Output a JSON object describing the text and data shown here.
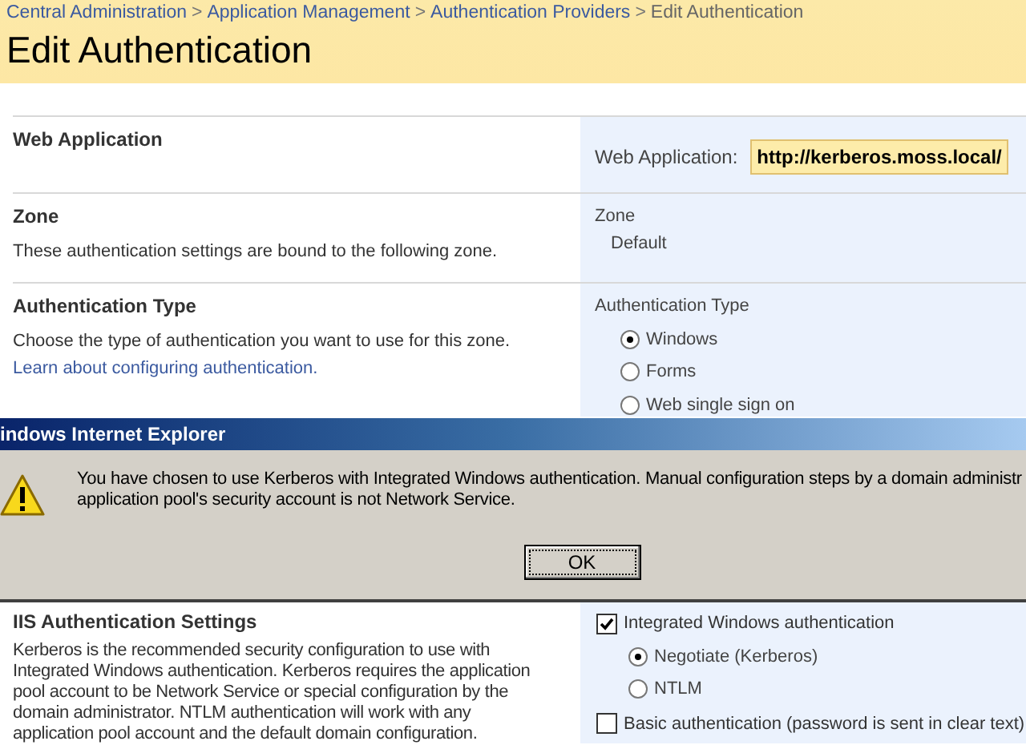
{
  "breadcrumb_separator": ">",
  "breadcrumb": [
    {
      "text": "Central Administration",
      "link": true
    },
    {
      "text": "Application Management",
      "link": true
    },
    {
      "text": "Authentication Providers",
      "link": true
    },
    {
      "text": "Edit Authentication",
      "link": false
    }
  ],
  "title": "Edit Authentication",
  "sections": [
    {
      "title": "Web Application",
      "items": [
        {
          "kind": "field",
          "label": "Web Application:",
          "value": "http://kerberos.moss.local/"
        }
      ]
    },
    {
      "title": "Zone",
      "description": "These authentication settings are bound to the following zone.",
      "items": [
        {
          "kind": "caption",
          "text": "Zone"
        },
        {
          "kind": "text",
          "text": "Default"
        }
      ]
    },
    {
      "title": "Authentication Type",
      "description": "Choose the type of authentication you want to use for this zone.",
      "link": "Learn about configuring authentication.",
      "items": [
        {
          "kind": "caption",
          "text": "Authentication Type"
        },
        {
          "kind": "radio",
          "text": "Windows",
          "selected": true
        },
        {
          "kind": "radio",
          "text": "Forms",
          "selected": false
        },
        {
          "kind": "radio",
          "text": "Web single sign on",
          "selected": false
        }
      ]
    }
  ],
  "dialog": {
    "title": "indows Internet Explorer",
    "message_lines": [
      "You have chosen to use Kerberos with Integrated Windows authentication. Manual configuration steps by a domain administr",
      "application pool's security account is not Network Service."
    ],
    "button": "OK"
  },
  "iis": {
    "title": "IIS Authentication Settings",
    "description_lines": [
      "Kerberos is the recommended security configuration to use with",
      "Integrated Windows authentication.  Kerberos requires the application",
      "pool account to be Network Service or special configuration by the",
      "domain administrator.  NTLM authentication will work with any",
      "application pool account and the default domain configuration."
    ],
    "items": [
      {
        "kind": "checkbox",
        "text": "Integrated Windows authentication",
        "checked": true,
        "children": [
          {
            "kind": "radio",
            "text": "Negotiate (Kerberos)",
            "selected": true
          },
          {
            "kind": "radio",
            "text": "NTLM",
            "selected": false
          }
        ]
      },
      {
        "kind": "checkbox",
        "text": "Basic authentication (password is sent in clear text)",
        "checked": false
      }
    ]
  }
}
